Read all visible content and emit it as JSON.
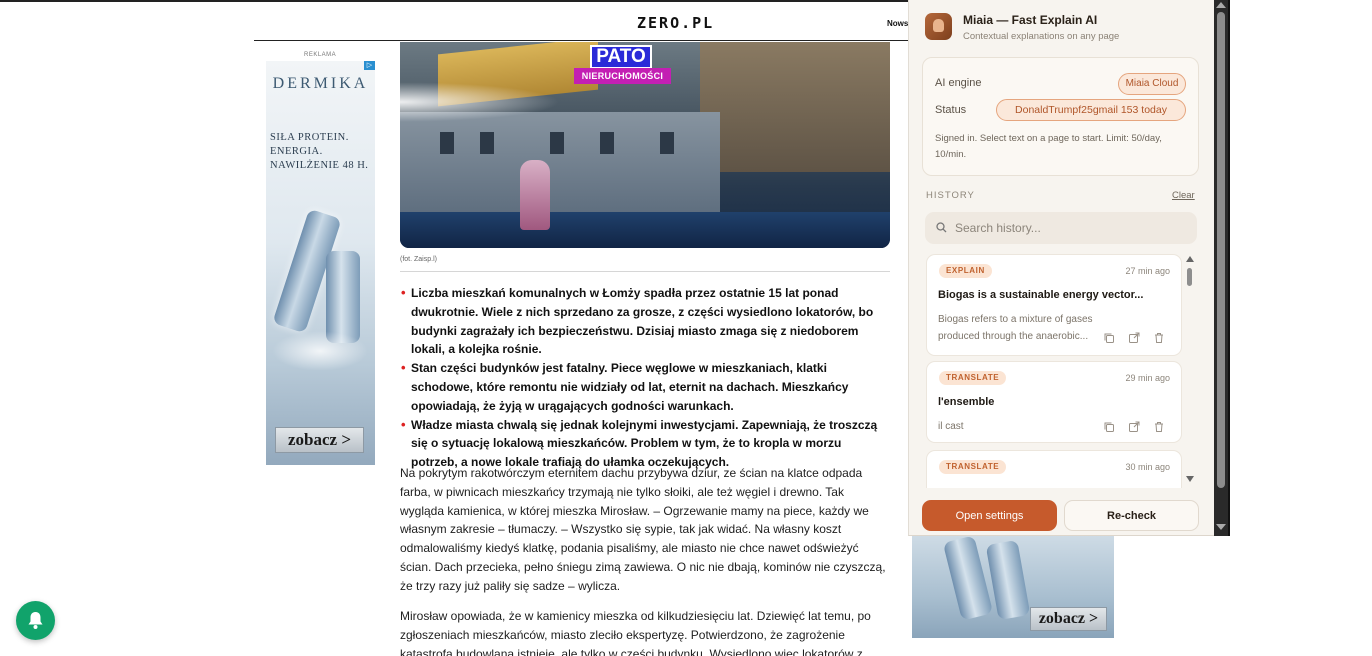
{
  "header": {
    "logo": "ZERO.PL",
    "nav_fragment": "Nows"
  },
  "ad_left": {
    "label": "REKLAMA",
    "brand": "DERMIKA",
    "tagline": "SIŁA PROTEIN. ENERGIA. NAWILŻENIE 48 H.",
    "cta": "zobacz >"
  },
  "ad_right": {
    "cta": "zobacz >"
  },
  "article": {
    "hero_badge_title": "PATO",
    "hero_badge_sub": "NIERUCHOMOŚCI",
    "caption": "(fot. Zaisp.l)",
    "bullets": [
      "Liczba mieszkań komunalnych w Łomży spadła przez ostatnie 15 lat ponad dwukrotnie. Wiele z nich sprzedano za grosze, z części wysiedlono lokatorów, bo budynki zagrażały ich bezpieczeństwu. Dzisiaj miasto zmaga się z niedoborem lokali, a kolejka rośnie.",
      "Stan części budynków jest fatalny. Piece węglowe w mieszkaniach, klatki schodowe, które remontu nie widziały od lat, eternit na dachach. Mieszkańcy opowiadają, że żyją w urągających godności warunkach.",
      "Władze miasta chwalą się jednak kolejnymi inwestycjami. Zapewniają, że troszczą się o sytuację lokalową mieszkańców. Problem w tym, że to kropla w morzu potrzeb, a nowe lokale trafiają do ułamka oczekujących."
    ],
    "paragraph1": "Na pokrytym rakotwórczym eternitem dachu przybywa dziur, ze ścian na klatce odpada farba, w piwnicach mieszkańcy trzymają nie tylko słoiki, ale też węgiel i drewno. Tak wygląda kamienica, w której mieszka Mirosław. – Ogrzewanie mamy na piece, każdy we własnym zakresie – tłumaczy. – Wszystko się sypie, tak jak widać. Na własny koszt odmalowaliśmy kiedyś klatkę, podania pisaliśmy, ale miasto nie chce nawet odświeżyć ścian. Dach przecieka, pełno śniegu zimą zawiewa. O nic nie dbają, kominów nie czyszczą, że trzy razy już paliły się sadze – wylicza.",
    "paragraph2": "Mirosław opowiada, że w kamienicy mieszka od kilkudziesięciu lat. Dziewięć lat temu, po zgłoszeniach mieszkańców, miasto zleciło ekspertyzę. Potwierdzono, że zagrożenie katastrofą budowlaną istnieje, ale tylko w części budynku. Wysiedlono więc lokatorów z części mieszkań."
  },
  "panel": {
    "title": "Miaia — Fast Explain AI",
    "subtitle": "Contextual explanations on any page",
    "engine_label": "AI engine",
    "engine_value": "Miaia Cloud",
    "status_label": "Status",
    "status_value": "DonaldTrumpf25gmail 153 today",
    "note": "Signed in. Select text on a page to start. Limit: 50/day, 10/min.",
    "history_label": "HISTORY",
    "clear_label": "Clear",
    "search_placeholder": "Search history...",
    "history": [
      {
        "tag": "EXPLAIN",
        "time": "27 min ago",
        "title": "Biogas is a sustainable energy vector...",
        "snippet": "Biogas refers to a mixture of gases produced through the anaerobic..."
      },
      {
        "tag": "TRANSLATE",
        "time": "29 min ago",
        "title": "l'ensemble",
        "snippet": "il cast"
      },
      {
        "tag": "TRANSLATE",
        "time": "30 min ago",
        "title": "",
        "snippet": ""
      }
    ],
    "open_settings": "Open settings",
    "recheck": "Re-check"
  },
  "colors": {
    "accent": "#c65a2c",
    "tag_bg": "#fbe4d3",
    "bell": "#11a36b",
    "bullet": "#dd2222"
  }
}
